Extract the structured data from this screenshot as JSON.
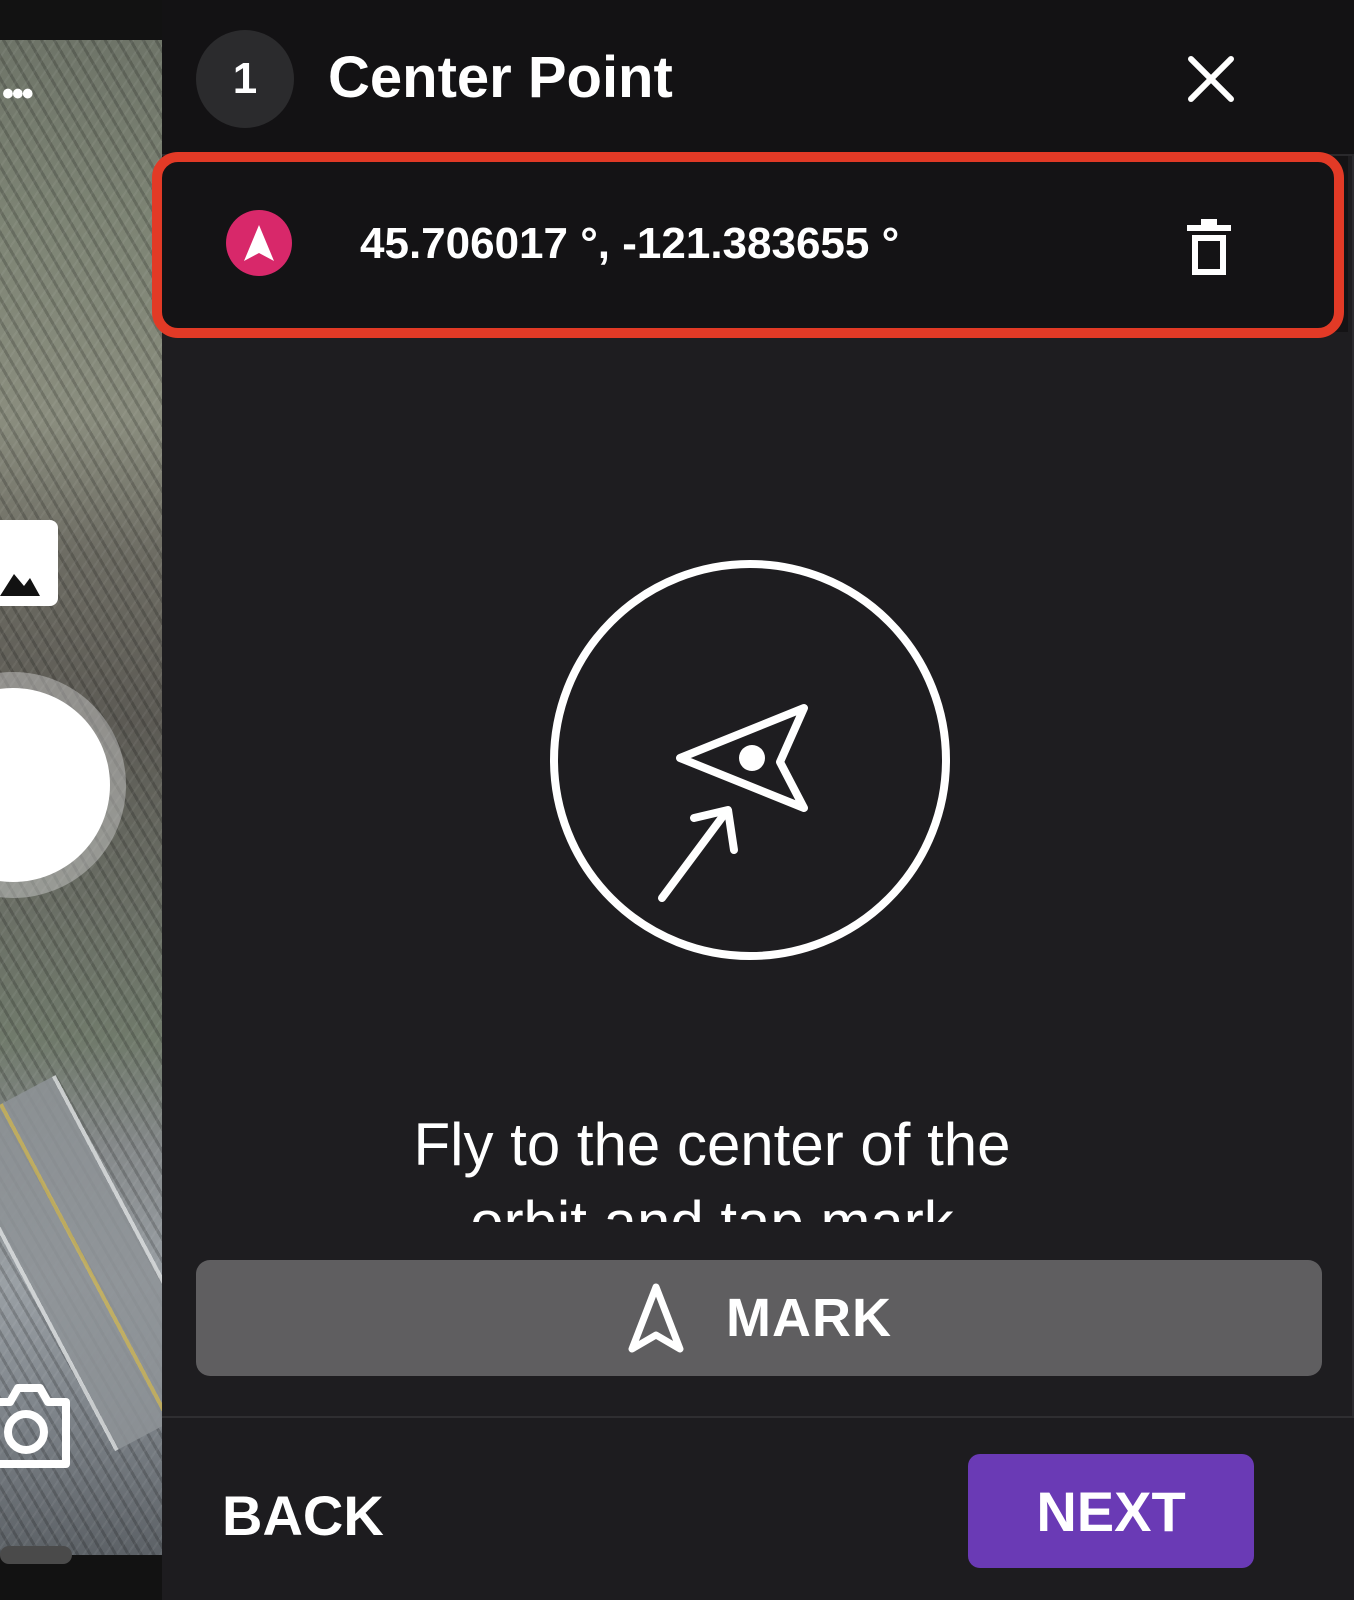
{
  "header": {
    "step_number": "1",
    "title": "Center Point",
    "close_icon": "close-icon"
  },
  "coordinate": {
    "text": "45.706017 °, -121.383655 °",
    "pin_icon": "navigation-arrow-icon",
    "delete_icon": "trash-icon",
    "pin_color": "#d8286a",
    "highlight_color": "#e23a26"
  },
  "illustration": {
    "icon": "fly-to-center-icon"
  },
  "instruction": {
    "text": "Fly to the center of the orbit and tap mark"
  },
  "mark_button": {
    "label": "MARK",
    "icon": "navigation-arrow-outline-icon"
  },
  "footer": {
    "back_label": "BACK",
    "next_label": "NEXT",
    "next_color": "#6a3ab5"
  },
  "camera_strip": {
    "more_icon": "more-dots-icon",
    "gallery_icon": "gallery-icon",
    "shutter_icon": "shutter-button",
    "camera_icon": "camera-switch-icon"
  }
}
